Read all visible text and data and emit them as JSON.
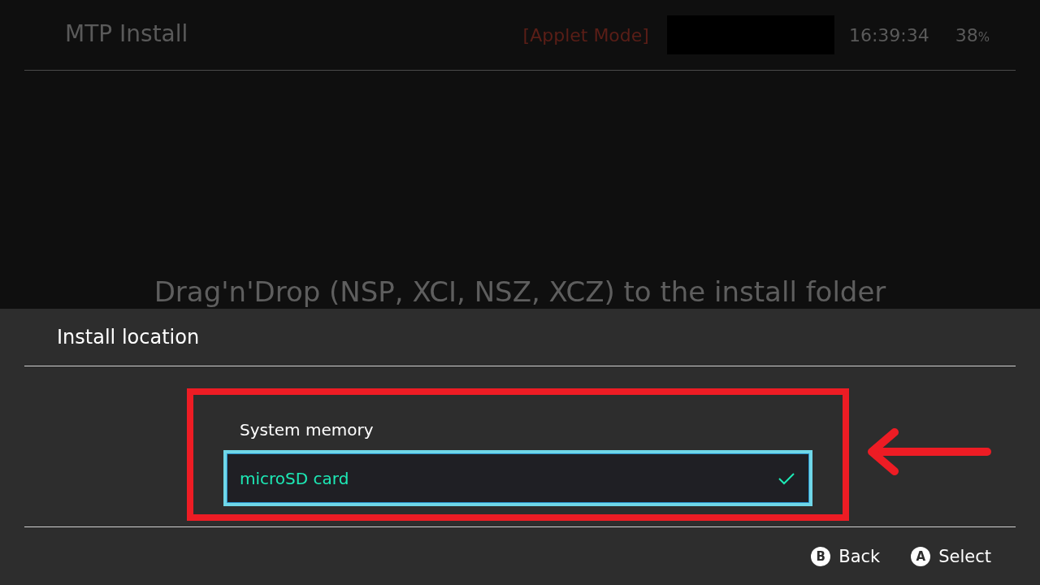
{
  "header": {
    "title": "MTP Install",
    "mode": "[Applet Mode]",
    "time": "16:39:34",
    "battery": "38",
    "battery_unit": "%"
  },
  "message": "Drag'n'Drop (NSP, XCI, NSZ, XCZ) to the install folder",
  "dialog": {
    "title": "Install location",
    "options": [
      {
        "label": "System memory",
        "selected": false
      },
      {
        "label": "microSD card",
        "selected": true
      }
    ],
    "buttons": [
      {
        "key": "B",
        "label": "Back"
      },
      {
        "key": "A",
        "label": "Select"
      }
    ]
  }
}
